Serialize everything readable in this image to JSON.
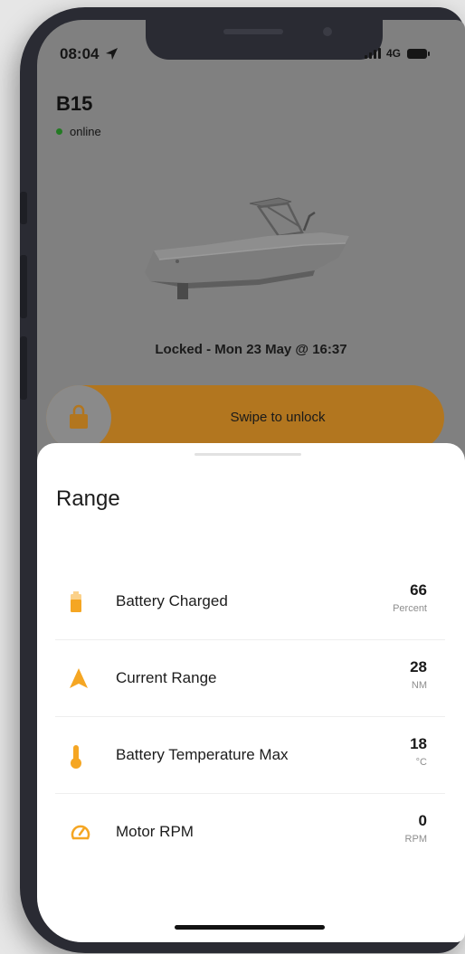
{
  "status_bar": {
    "time": "08:04",
    "network": "4G",
    "icons": [
      "location-arrow-icon",
      "signal-icon",
      "battery-icon"
    ]
  },
  "vessel": {
    "name": "B15",
    "status": "online",
    "status_color": "#237a23"
  },
  "lock": {
    "status_text": "Locked - Mon 23 May @ 16:37",
    "slider_label": "Swipe to unlock",
    "icon": "lock-icon",
    "accent_color": "#b2761f"
  },
  "range_sheet": {
    "title": "Range",
    "accent_color": "#f5a623",
    "metrics": [
      {
        "label": "Battery Charged",
        "value": "66",
        "unit": "Percent",
        "icon": "battery-charged-icon"
      },
      {
        "label": "Current Range",
        "value": "28",
        "unit": "NM",
        "icon": "navigation-arrow-icon"
      },
      {
        "label": "Battery Temperature Max",
        "value": "18",
        "unit": "°C",
        "icon": "thermometer-icon"
      },
      {
        "label": "Motor RPM",
        "value": "0",
        "unit": "RPM",
        "icon": "speedometer-icon"
      }
    ]
  }
}
